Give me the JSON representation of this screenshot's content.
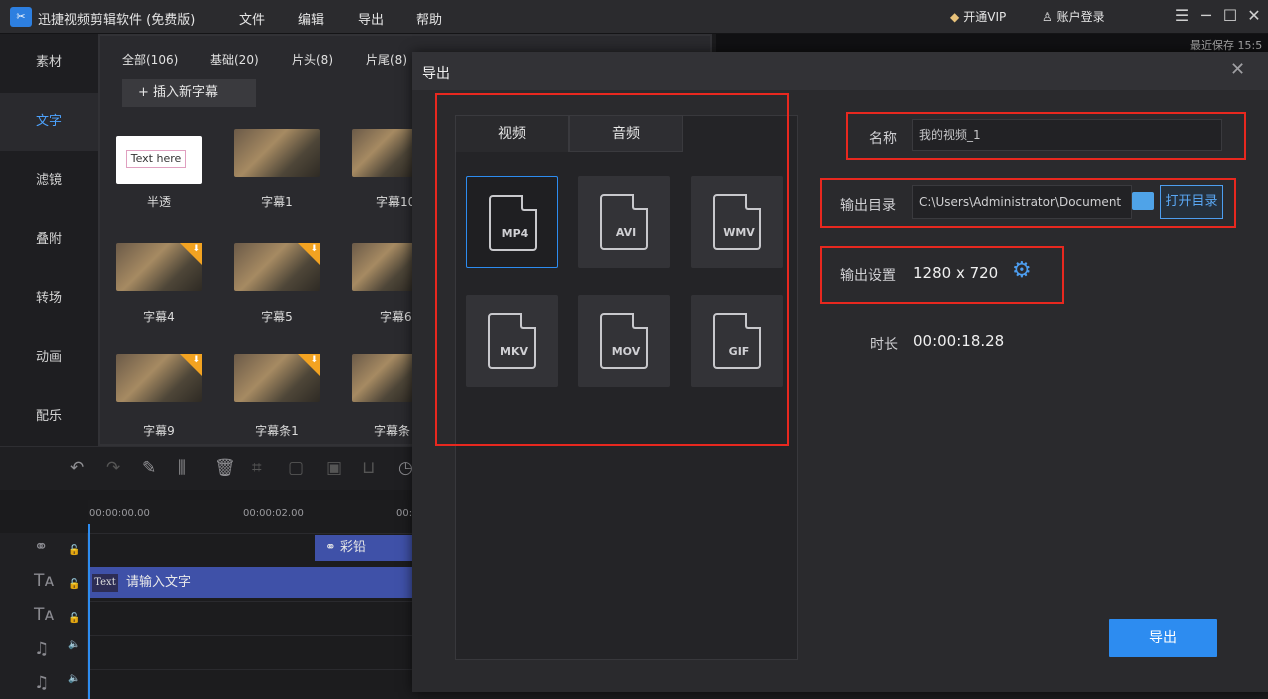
{
  "titlebar": {
    "app_title": "迅捷视频剪辑软件 (免费版)",
    "menu": [
      "文件",
      "编辑",
      "导出",
      "帮助"
    ],
    "vip": "开通VIP",
    "login": "账户登录"
  },
  "leftnav": [
    "素材",
    "文字",
    "滤镜",
    "叠附",
    "转场",
    "动画",
    "配乐"
  ],
  "library": {
    "tabs": [
      "全部(106)",
      "基础(20)",
      "片头(8)",
      "片尾(8)"
    ],
    "insert_button": "+ 插入新字幕",
    "items": [
      {
        "label": "半透",
        "preview_text": "Text here"
      },
      {
        "label": "字幕1"
      },
      {
        "label": "字幕10"
      },
      {
        "label": "字幕4"
      },
      {
        "label": "字幕5"
      },
      {
        "label": "字幕6"
      },
      {
        "label": "字幕9"
      },
      {
        "label": "字幕条1"
      },
      {
        "label": "字幕条"
      }
    ]
  },
  "preview": {
    "saved_text": "最近保存 15:5"
  },
  "timeline": {
    "ruler": [
      "00:00:00.00",
      "00:00:02.00",
      "00:"
    ],
    "clip_pencil": "彩铅",
    "clip_text_tag": "Text",
    "clip_text": "请输入文字"
  },
  "dialog": {
    "title": "导出",
    "tabs": [
      "视频",
      "音频"
    ],
    "formats": [
      "MP4",
      "AVI",
      "WMV",
      "MKV",
      "MOV",
      "GIF"
    ],
    "name_label": "名称",
    "name_value": "我的视频_1",
    "dir_label": "输出目录",
    "dir_value": "C:\\Users\\Administrator\\Document",
    "open_dir": "打开目录",
    "settings_label": "输出设置",
    "resolution": "1280 x 720",
    "duration_label": "时长",
    "duration": "00:00:18.28",
    "export_button": "导出"
  }
}
